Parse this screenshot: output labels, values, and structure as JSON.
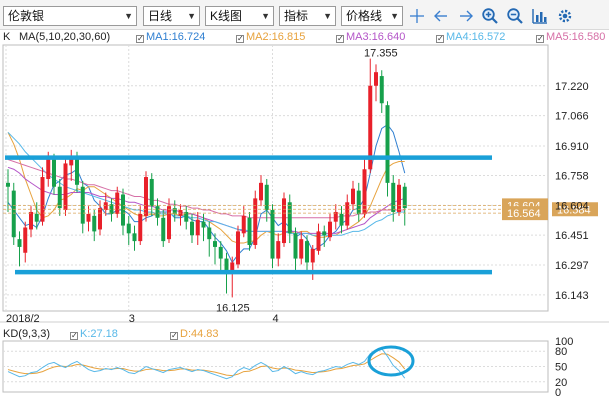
{
  "toolbar": {
    "symbol": "伦敦银",
    "period": "日线",
    "chart_type": "K线图",
    "indicator": "指标",
    "price_mode": "价格线"
  },
  "legend": {
    "main_title": "K",
    "ma_title": "MA(5,10,20,30,60)",
    "ma1": "MA1:16.724",
    "ma2": "MA2:16.815",
    "ma3": "MA3:16.640",
    "ma4": "MA4:16.572",
    "ma5": "MA5:16.580"
  },
  "kd_legend": {
    "title": "KD(9,3,3)",
    "k": "K:27.18",
    "d": "D:44.83"
  },
  "colors": {
    "up": "#e8202a",
    "down": "#16a04b",
    "ma1": "#2f7fd1",
    "ma2": "#e7a23d",
    "ma3": "#b455c8",
    "ma4": "#58b8e8",
    "ma5": "#d66fa6",
    "channel": "#1aa0d8",
    "grid": "#dcdcdc",
    "price_tag": "#d9a55a"
  },
  "icons": [
    "crosshair-icon",
    "arrow-left-icon",
    "arrow-right-icon",
    "zoom-in-icon",
    "zoom-out-icon",
    "chart-bars-icon",
    "settings-icon"
  ],
  "chart_data": {
    "type": "candlestick",
    "ylim": [
      16.06,
      17.43
    ],
    "y_ticks": [
      "17.220",
      "17.066",
      "16.910",
      "16.758",
      "16.604",
      "16.451",
      "16.297",
      "16.143"
    ],
    "x_labels": [
      "2018/2",
      "3",
      "4"
    ],
    "annotations": {
      "high": "17.355",
      "low": "16.125"
    },
    "price_tags": [
      "16.604",
      "16.584",
      "16.564"
    ],
    "candles": [
      [
        16.72,
        16.7,
        16.79,
        16.57
      ],
      [
        16.68,
        16.44,
        16.72,
        16.4
      ],
      [
        16.43,
        16.39,
        16.47,
        16.29
      ],
      [
        16.36,
        16.49,
        16.52,
        16.31
      ],
      [
        16.48,
        16.57,
        16.6,
        16.44
      ],
      [
        16.56,
        16.52,
        16.62,
        16.48
      ],
      [
        16.52,
        16.75,
        16.8,
        16.5
      ],
      [
        16.74,
        16.85,
        16.88,
        16.7
      ],
      [
        16.84,
        16.7,
        16.87,
        16.66
      ],
      [
        16.7,
        16.59,
        16.74,
        16.55
      ],
      [
        16.58,
        16.82,
        16.86,
        16.55
      ],
      [
        16.81,
        16.86,
        16.89,
        16.73
      ],
      [
        16.85,
        16.71,
        16.88,
        16.67
      ],
      [
        16.7,
        16.51,
        16.73,
        16.46
      ],
      [
        16.52,
        16.56,
        16.6,
        16.47
      ],
      [
        16.55,
        16.47,
        16.58,
        16.42
      ],
      [
        16.48,
        16.59,
        16.63,
        16.45
      ],
      [
        16.58,
        16.62,
        16.67,
        16.55
      ],
      [
        16.61,
        16.56,
        16.64,
        16.52
      ],
      [
        16.56,
        16.67,
        16.7,
        16.54
      ],
      [
        16.66,
        16.5,
        16.69,
        16.45
      ],
      [
        16.51,
        16.46,
        16.55,
        16.4
      ],
      [
        16.46,
        16.42,
        16.5,
        16.37
      ],
      [
        16.42,
        16.56,
        16.6,
        16.4
      ],
      [
        16.55,
        16.75,
        16.78,
        16.52
      ],
      [
        16.74,
        16.6,
        16.77,
        16.55
      ],
      [
        16.6,
        16.54,
        16.64,
        16.5
      ],
      [
        16.54,
        16.42,
        16.58,
        16.39
      ],
      [
        16.43,
        16.6,
        16.64,
        16.41
      ],
      [
        16.59,
        16.56,
        16.63,
        16.52
      ],
      [
        16.55,
        16.58,
        16.61,
        16.5
      ],
      [
        16.57,
        16.52,
        16.6,
        16.48
      ],
      [
        16.52,
        16.45,
        16.56,
        16.41
      ],
      [
        16.45,
        16.53,
        16.57,
        16.4
      ],
      [
        16.52,
        16.49,
        16.56,
        16.42
      ],
      [
        16.49,
        16.43,
        16.52,
        16.34
      ],
      [
        16.42,
        16.39,
        16.46,
        16.3
      ],
      [
        16.39,
        16.33,
        16.42,
        16.26
      ],
      [
        16.33,
        16.25,
        16.36,
        16.15
      ],
      [
        16.26,
        16.31,
        16.34,
        16.13
      ],
      [
        16.3,
        16.47,
        16.5,
        16.28
      ],
      [
        16.46,
        16.55,
        16.6,
        16.44
      ],
      [
        16.54,
        16.4,
        16.57,
        16.37
      ],
      [
        16.4,
        16.64,
        16.68,
        16.38
      ],
      [
        16.63,
        16.72,
        16.76,
        16.6
      ],
      [
        16.71,
        16.58,
        16.74,
        16.52
      ],
      [
        16.58,
        16.33,
        16.61,
        16.28
      ],
      [
        16.33,
        16.42,
        16.46,
        16.29
      ],
      [
        16.41,
        16.64,
        16.67,
        16.39
      ],
      [
        16.62,
        16.46,
        16.66,
        16.41
      ],
      [
        16.46,
        16.33,
        16.49,
        16.27
      ],
      [
        16.33,
        16.43,
        16.47,
        16.3
      ],
      [
        16.42,
        16.31,
        16.45,
        16.27
      ],
      [
        16.31,
        16.38,
        16.4,
        16.22
      ],
      [
        16.37,
        16.47,
        16.51,
        16.35
      ],
      [
        16.47,
        16.45,
        16.5,
        16.39
      ],
      [
        16.44,
        16.52,
        16.56,
        16.42
      ],
      [
        16.52,
        16.57,
        16.61,
        16.48
      ],
      [
        16.56,
        16.5,
        16.6,
        16.46
      ],
      [
        16.5,
        16.62,
        16.66,
        16.48
      ],
      [
        16.61,
        16.69,
        16.73,
        16.58
      ],
      [
        16.68,
        16.56,
        16.72,
        16.52
      ],
      [
        16.56,
        16.79,
        16.85,
        16.54
      ],
      [
        16.79,
        17.22,
        17.36,
        16.77
      ],
      [
        17.22,
        17.29,
        17.33,
        17.14
      ],
      [
        17.27,
        17.13,
        17.3,
        17.08
      ],
      [
        17.12,
        16.72,
        17.14,
        16.65
      ],
      [
        16.72,
        16.57,
        16.76,
        16.52
      ],
      [
        16.57,
        16.71,
        16.74,
        16.55
      ],
      [
        16.7,
        16.59,
        16.72,
        16.5
      ]
    ],
    "ma_series": {
      "MA1": [
        16.62,
        16.58,
        16.54,
        16.5,
        16.51,
        16.49,
        16.55,
        16.64,
        16.71,
        16.73,
        16.76,
        16.77,
        16.79,
        16.72,
        16.7,
        16.63,
        16.6,
        16.56,
        16.56,
        16.58,
        16.58,
        16.56,
        16.52,
        16.52,
        16.54,
        16.55,
        16.57,
        16.57,
        16.57,
        16.54,
        16.54,
        16.55,
        16.53,
        16.52,
        16.52,
        16.48,
        16.44,
        16.41,
        16.37,
        16.31,
        16.35,
        16.38,
        16.38,
        16.44,
        16.56,
        16.58,
        16.54,
        16.5,
        16.52,
        16.49,
        16.44,
        16.46,
        16.43,
        16.37,
        16.39,
        16.41,
        16.45,
        16.47,
        16.51,
        16.53,
        16.58,
        16.59,
        16.64,
        16.77,
        16.91,
        17.0,
        17.02,
        16.98,
        16.88,
        16.77
      ],
      "MA2": [
        16.98,
        16.92,
        16.84,
        16.74,
        16.66,
        16.58,
        16.54,
        16.55,
        16.58,
        16.63,
        16.64,
        16.66,
        16.69,
        16.68,
        16.7,
        16.7,
        16.68,
        16.66,
        16.64,
        16.62,
        16.6,
        16.58,
        16.56,
        16.55,
        16.55,
        16.56,
        16.55,
        16.55,
        16.56,
        16.56,
        16.55,
        16.56,
        16.56,
        16.55,
        16.54,
        16.52,
        16.5,
        16.48,
        16.45,
        16.42,
        16.41,
        16.41,
        16.42,
        16.42,
        16.45,
        16.47,
        16.46,
        16.45,
        16.46,
        16.47,
        16.46,
        16.47,
        16.47,
        16.45,
        16.44,
        16.44,
        16.45,
        16.45,
        16.47,
        16.48,
        16.5,
        16.52,
        16.55,
        16.6,
        16.67,
        16.74,
        16.8,
        16.82,
        16.83,
        16.83
      ],
      "MA3": [
        16.8,
        16.79,
        16.77,
        16.74,
        16.72,
        16.7,
        16.68,
        16.67,
        16.66,
        16.66,
        16.66,
        16.67,
        16.67,
        16.67,
        16.67,
        16.66,
        16.65,
        16.65,
        16.64,
        16.64,
        16.63,
        16.62,
        16.62,
        16.61,
        16.6,
        16.6,
        16.59,
        16.58,
        16.58,
        16.58,
        16.57,
        16.56,
        16.56,
        16.55,
        16.54,
        16.53,
        16.52,
        16.51,
        16.5,
        16.49,
        16.48,
        16.47,
        16.47,
        16.47,
        16.47,
        16.47,
        16.47,
        16.47,
        16.47,
        16.47,
        16.47,
        16.46,
        16.46,
        16.46,
        16.46,
        16.46,
        16.46,
        16.46,
        16.47,
        16.48,
        16.49,
        16.5,
        16.51,
        16.54,
        16.56,
        16.58,
        16.6,
        16.62,
        16.63,
        16.64
      ],
      "MA4": [
        16.98,
        16.95,
        16.92,
        16.88,
        16.85,
        16.82,
        16.79,
        16.76,
        16.74,
        16.72,
        16.7,
        16.69,
        16.68,
        16.67,
        16.66,
        16.65,
        16.64,
        16.63,
        16.62,
        16.61,
        16.6,
        16.59,
        16.58,
        16.58,
        16.57,
        16.57,
        16.56,
        16.56,
        16.56,
        16.55,
        16.55,
        16.55,
        16.54,
        16.54,
        16.53,
        16.52,
        16.52,
        16.51,
        16.5,
        16.49,
        16.48,
        16.48,
        16.47,
        16.47,
        16.47,
        16.47,
        16.47,
        16.47,
        16.47,
        16.46,
        16.46,
        16.46,
        16.46,
        16.45,
        16.45,
        16.45,
        16.45,
        16.45,
        16.45,
        16.46,
        16.47,
        16.47,
        16.48,
        16.5,
        16.52,
        16.53,
        16.55,
        16.56,
        16.57,
        16.57
      ],
      "MA5": [
        16.84,
        16.83,
        16.82,
        16.81,
        16.8,
        16.79,
        16.78,
        16.77,
        16.76,
        16.75,
        16.74,
        16.74,
        16.73,
        16.72,
        16.71,
        16.71,
        16.7,
        16.69,
        16.68,
        16.68,
        16.67,
        16.66,
        16.65,
        16.65,
        16.64,
        16.63,
        16.63,
        16.62,
        16.61,
        16.61,
        16.6,
        16.6,
        16.59,
        16.59,
        16.58,
        16.58,
        16.57,
        16.56,
        16.56,
        16.55,
        16.55,
        16.55,
        16.54,
        16.54,
        16.54,
        16.54,
        16.54,
        16.54,
        16.54,
        16.54,
        16.54,
        16.54,
        16.54,
        16.54,
        16.54,
        16.54,
        16.54,
        16.54,
        16.55,
        16.55,
        16.55,
        16.56,
        16.56,
        16.57,
        16.57,
        16.58,
        16.58,
        16.58,
        16.58,
        16.58
      ]
    },
    "channel_lines": [
      16.85,
      16.26
    ],
    "kd": {
      "ylim": [
        0,
        100
      ],
      "y_ticks": [
        "100",
        "80",
        "50",
        "20",
        "0"
      ],
      "K": [
        40,
        35,
        30,
        32,
        38,
        40,
        48,
        55,
        58,
        52,
        48,
        55,
        60,
        52,
        44,
        40,
        42,
        46,
        44,
        48,
        44,
        38,
        36,
        42,
        50,
        46,
        42,
        38,
        44,
        46,
        48,
        44,
        40,
        44,
        42,
        38,
        34,
        30,
        26,
        30,
        42,
        48,
        44,
        52,
        58,
        52,
        40,
        42,
        50,
        44,
        36,
        40,
        36,
        34,
        40,
        42,
        46,
        50,
        48,
        54,
        58,
        54,
        60,
        75,
        82,
        85,
        70,
        52,
        42,
        27
      ],
      "D": [
        44,
        41,
        38,
        36,
        36,
        37,
        40,
        45,
        49,
        51,
        50,
        51,
        54,
        53,
        50,
        47,
        45,
        45,
        45,
        46,
        46,
        43,
        41,
        41,
        44,
        45,
        44,
        42,
        42,
        43,
        45,
        45,
        43,
        43,
        43,
        41,
        39,
        36,
        33,
        32,
        35,
        40,
        41,
        45,
        50,
        51,
        47,
        45,
        47,
        46,
        43,
        42,
        40,
        38,
        39,
        40,
        42,
        45,
        46,
        49,
        52,
        53,
        55,
        62,
        69,
        75,
        74,
        67,
        59,
        45
      ]
    }
  }
}
